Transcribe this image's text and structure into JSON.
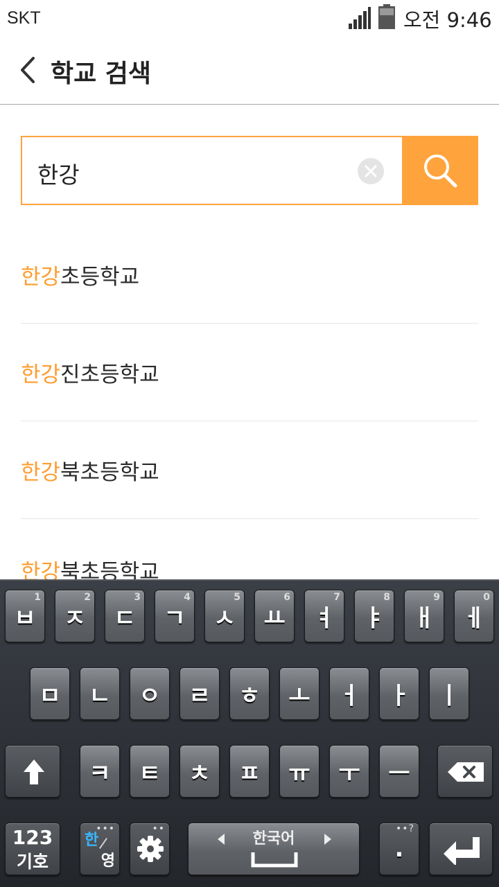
{
  "status_bar": {
    "carrier": "SKT",
    "time": "오전 9:46"
  },
  "header": {
    "title": "학교 검색"
  },
  "search": {
    "query": "한강"
  },
  "results": [
    {
      "highlight": "한강",
      "rest": "초등학교"
    },
    {
      "highlight": "한강",
      "rest": "진초등학교"
    },
    {
      "highlight": "한강",
      "rest": "북초등학교"
    }
  ],
  "partial_result": {
    "highlight": "한강",
    "rest": "북초등학교"
  },
  "keyboard": {
    "row1": [
      {
        "label": "ㅂ",
        "num": "1"
      },
      {
        "label": "ㅈ",
        "num": "2"
      },
      {
        "label": "ㄷ",
        "num": "3"
      },
      {
        "label": "ㄱ",
        "num": "4"
      },
      {
        "label": "ㅅ",
        "num": "5"
      },
      {
        "label": "ㅛ",
        "num": "6"
      },
      {
        "label": "ㅕ",
        "num": "7"
      },
      {
        "label": "ㅑ",
        "num": "8"
      },
      {
        "label": "ㅐ",
        "num": "9"
      },
      {
        "label": "ㅔ",
        "num": "0"
      }
    ],
    "row2": [
      "ㅁ",
      "ㄴ",
      "ㅇ",
      "ㄹ",
      "ㅎ",
      "ㅗ",
      "ㅓ",
      "ㅏ",
      "ㅣ"
    ],
    "row3": [
      "ㅋ",
      "ㅌ",
      "ㅊ",
      "ㅍ",
      "ㅠ",
      "ㅜ",
      "ㅡ"
    ],
    "sym_top": "123",
    "sym_bottom": "기호",
    "lang_ko": "한",
    "lang_en": "영",
    "space_label": "한국어",
    "period": ".",
    "accent_color": "#ffa43c",
    "highlight_color": "#ff9c2e"
  }
}
